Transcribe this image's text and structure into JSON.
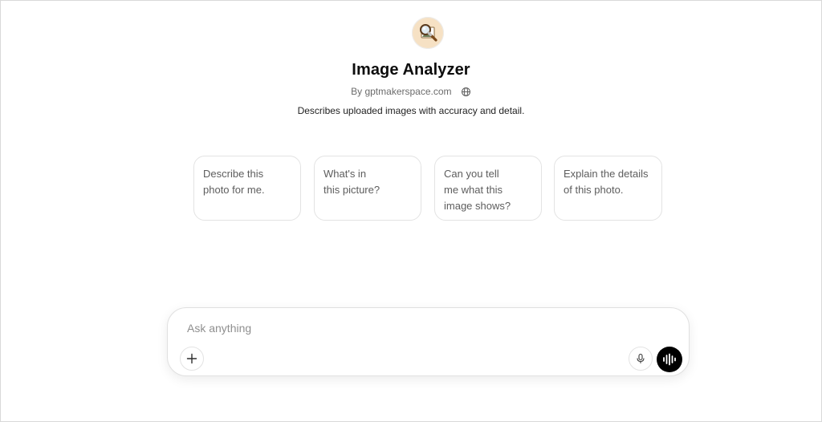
{
  "gpt": {
    "name": "Image Analyzer",
    "byline": "By gptmakerspace.com",
    "description": "Describes uploaded images with accuracy and detail."
  },
  "starters": [
    "Describe this\nphoto for me.",
    "What's in\nthis picture?",
    "Can you tell\nme what this\nimage shows?",
    "Explain the details\nof this photo."
  ],
  "composer": {
    "placeholder": "Ask anything",
    "value": ""
  },
  "icons": {
    "avatar": "magnifying-glass-over-picture-avatar",
    "byline": "globe-icon",
    "attach": "plus-icon",
    "dictate": "microphone-icon",
    "voice": "voice-waveform-icon"
  },
  "colors": {
    "voice_button": "#000000",
    "avatar_bg": "#f6e1c4"
  }
}
